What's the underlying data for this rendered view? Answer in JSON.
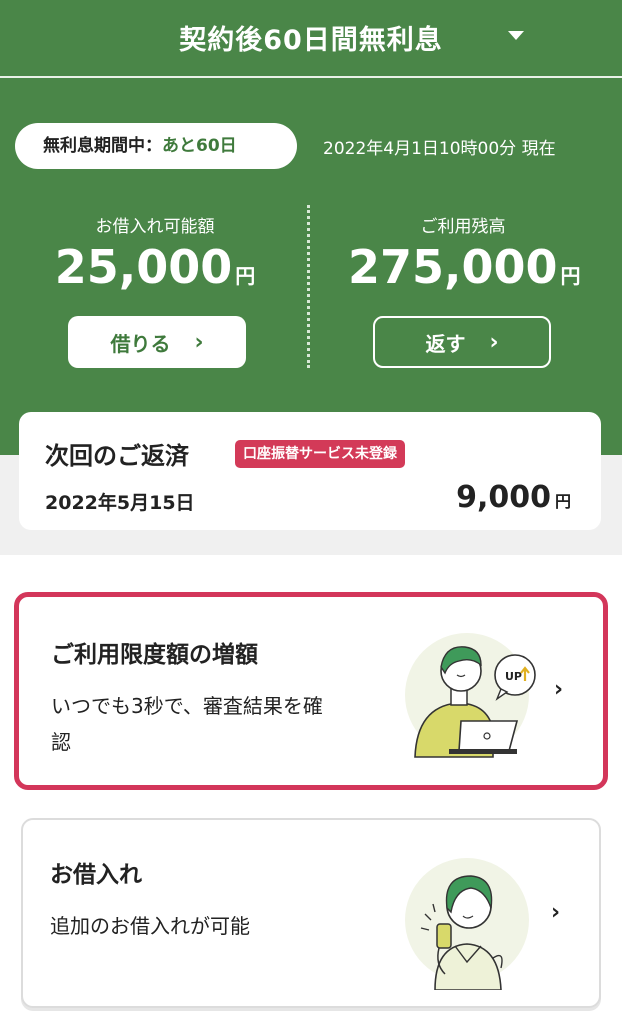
{
  "header": {
    "title": "契約後60日間無利息"
  },
  "status": {
    "period_label": "無利息期間中：",
    "period_value": "あと60日",
    "timestamp": "2022年4月1日10時00分 現在"
  },
  "available": {
    "label": "お借入れ可能額",
    "amount": "25,000",
    "unit": "円",
    "button": "借りる"
  },
  "balance": {
    "label": "ご利用残高",
    "amount": "275,000",
    "unit": "円",
    "button": "返す"
  },
  "next_repayment": {
    "title": "次回のご返済",
    "badge": "口座振替サービス未登録",
    "date": "2022年5月15日",
    "amount": "9,000",
    "unit": "円"
  },
  "cards": [
    {
      "title": "ご利用限度額の増額",
      "desc_line1": "いつでも3秒で、審査結果を確",
      "desc_line2": "認",
      "illus_text": "UP"
    },
    {
      "title": "お借入れ",
      "desc_line1": "追加のお借入れが可能"
    }
  ],
  "colors": {
    "brand_green": "#4a8648",
    "accent_red": "#d3365a"
  }
}
